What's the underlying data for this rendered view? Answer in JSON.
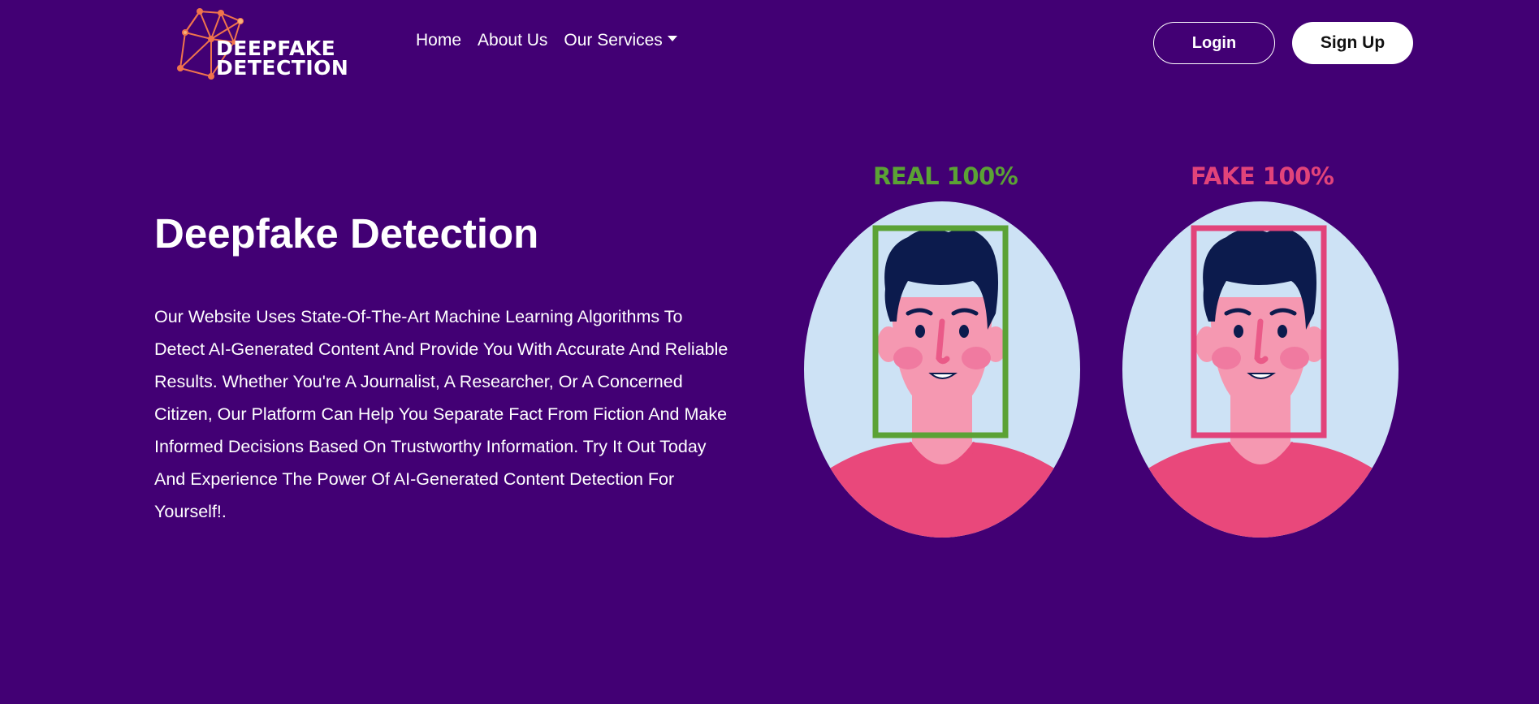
{
  "brand": {
    "logo_line1": "DEEPFAKE",
    "logo_line2": "DETECTION"
  },
  "nav": {
    "home": "Home",
    "about": "About Us",
    "services": "Our Services"
  },
  "auth": {
    "login": "Login",
    "signup": "Sign Up"
  },
  "hero": {
    "title": "Deepfake Detection",
    "description": "Our Website Uses State-Of-The-Art Machine Learning Algorithms To Detect AI-Generated Content And Provide You With Accurate And Reliable Results. Whether You're A Journalist, A Researcher, Or A Concerned Citizen, Our Platform Can Help You Separate Fact From Fiction And Make Informed Decisions Based On Trustworthy Information. Try It Out Today And Experience The Power Of AI-Generated Content Detection For Yourself!."
  },
  "illustration": {
    "real_label": "REAL 100%",
    "fake_label": "FAKE 100%"
  },
  "colors": {
    "background": "#420074",
    "real_green": "#5ba235",
    "fake_pink": "#e2437a",
    "logo_orange": "#f0744c"
  }
}
